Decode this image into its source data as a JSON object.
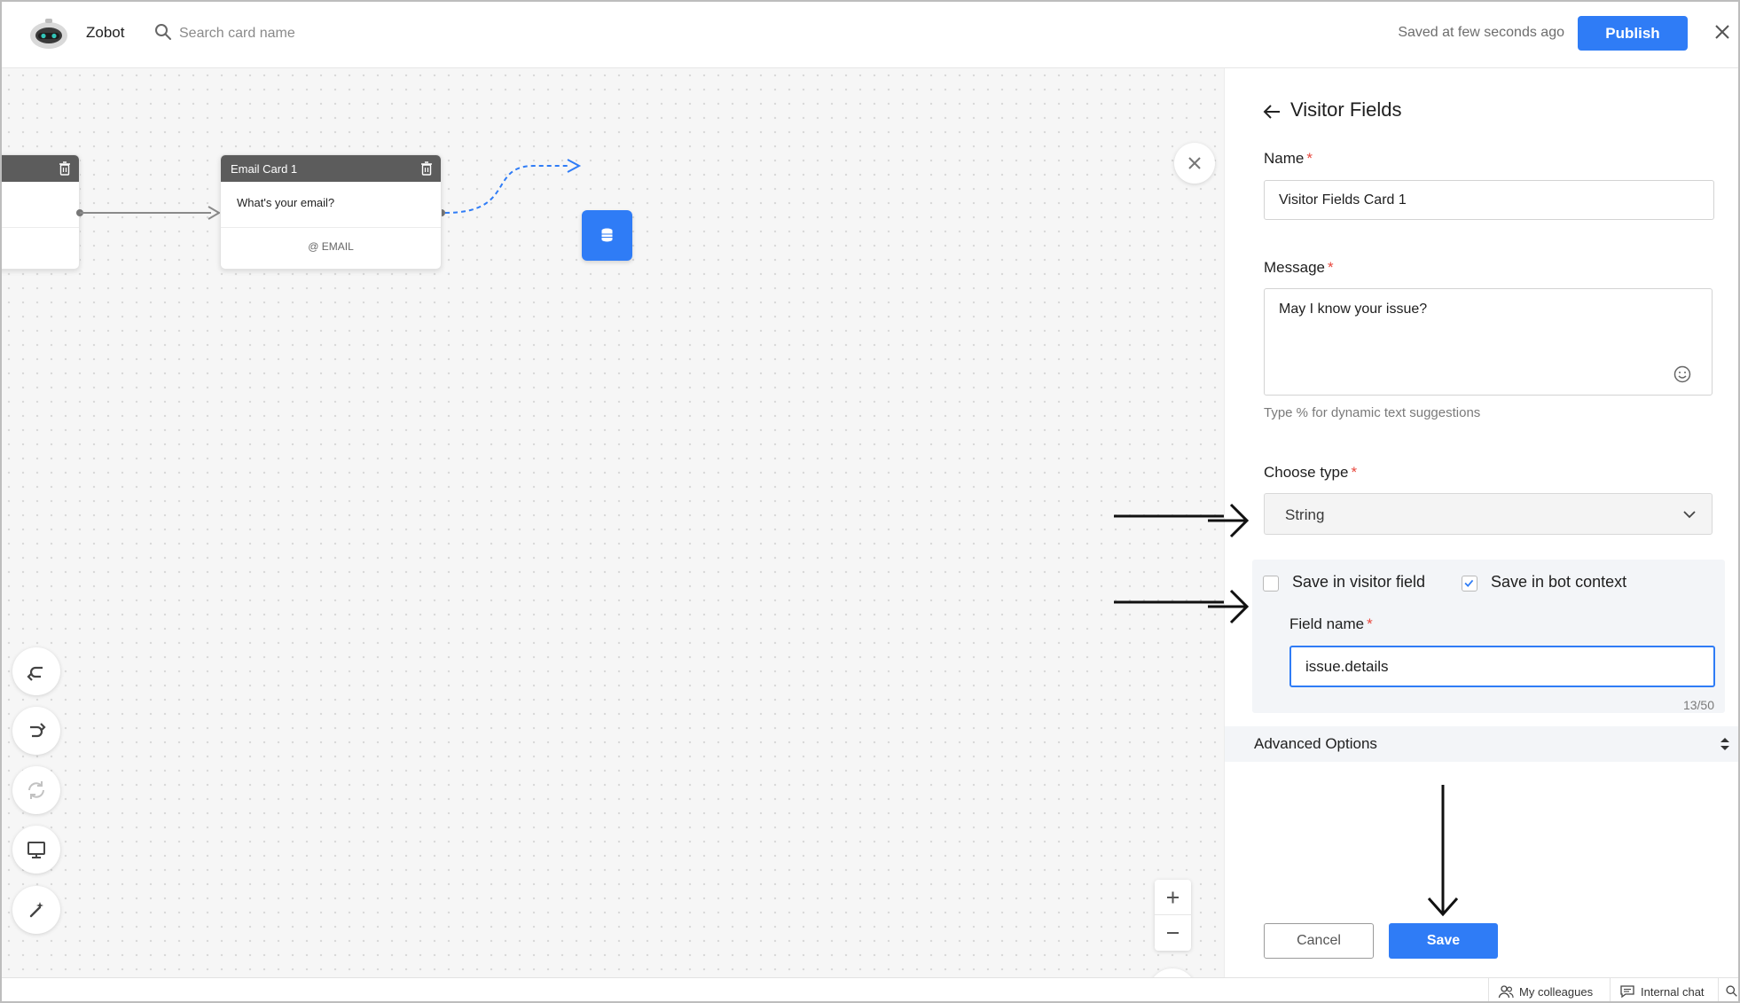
{
  "header": {
    "app_name": "Zobot",
    "search_placeholder": "Search card name",
    "saved_status": "Saved at few seconds ago",
    "publish_label": "Publish"
  },
  "canvas": {
    "email_card": {
      "title": "Email Card 1",
      "message": "What's your email?",
      "type_label": "EMAIL"
    }
  },
  "panel": {
    "title": "Visitor Fields",
    "name_label": "Name",
    "name_value": "Visitor Fields Card 1",
    "message_label": "Message",
    "message_value": "May I know your issue?",
    "message_hint": "Type % for dynamic text suggestions",
    "type_label": "Choose type",
    "type_value": "String",
    "save_visitor_label": "Save in visitor field",
    "save_visitor_checked": false,
    "save_bot_label": "Save in bot context",
    "save_bot_checked": true,
    "field_name_label": "Field name",
    "field_name_value": "issue.details",
    "field_counter": "13/50",
    "advanced_label": "Advanced Options",
    "cancel_label": "Cancel",
    "save_label": "Save",
    "required_mark": "*"
  },
  "footer": {
    "colleagues_label": "My colleagues",
    "chat_label": "Internal chat"
  },
  "colors": {
    "accent": "#2f7cf6",
    "required": "#e8473d",
    "card_header": "#5c5c5c"
  }
}
